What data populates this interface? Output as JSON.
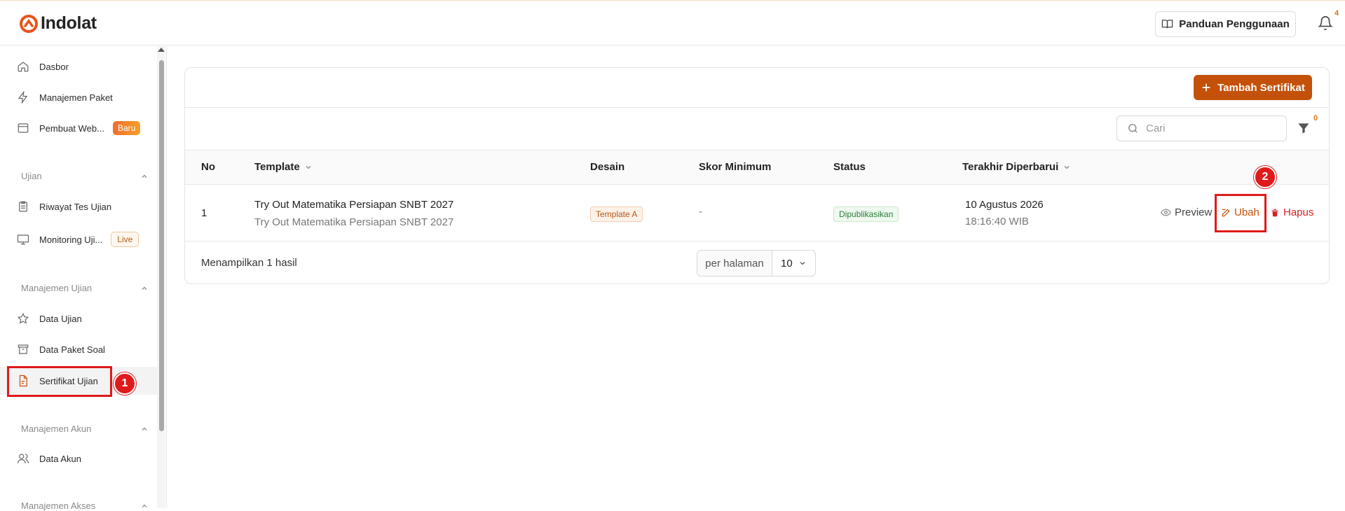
{
  "header": {
    "logo_text": "Indolat",
    "guide_label": "Panduan Penggunaan",
    "notification_count": "4",
    "brand_color": "#e8541a"
  },
  "sidebar": {
    "items_top": [
      {
        "label": "Dasbor",
        "icon": "home-icon"
      },
      {
        "label": "Manajemen Paket",
        "icon": "bolt-icon"
      },
      {
        "label": "Pembuat Web...",
        "icon": "browser-icon",
        "badge": "Baru"
      }
    ],
    "section_ujian": "Ujian",
    "items_ujian": [
      {
        "label": "Riwayat Tes Ujian",
        "icon": "clipboard-icon"
      },
      {
        "label": "Monitoring Uji...",
        "icon": "monitor-icon",
        "badge": "Live"
      }
    ],
    "section_manajemen_ujian": "Manajemen Ujian",
    "items_manajemen_ujian": [
      {
        "label": "Data Ujian",
        "icon": "star-icon"
      },
      {
        "label": "Data Paket Soal",
        "icon": "archive-icon"
      },
      {
        "label": "Sertifikat Ujian",
        "icon": "document-icon",
        "active": true
      }
    ],
    "section_manajemen_akun": "Manajemen Akun",
    "items_manajemen_akun": [
      {
        "label": "Data Akun",
        "icon": "users-icon"
      }
    ],
    "section_manajemen_akses": "Manajemen Akses"
  },
  "toolbar": {
    "add_label": "Tambah Sertifikat",
    "search_placeholder": "Cari",
    "filter_count": "0"
  },
  "table": {
    "columns": [
      "No",
      "Template",
      "Desain",
      "Skor Minimum",
      "Status",
      "Terakhir Diperbarui"
    ],
    "rows": [
      {
        "no": "1",
        "template_title": "Try Out Matematika Persiapan SNBT 2027",
        "template_subtitle": "Try Out Matematika Persiapan SNBT 2027",
        "design": "Template A",
        "min_score": "-",
        "status": "Dipublikasikan",
        "updated_date": "10 Agustus 2026",
        "updated_time": "18:16:40 WIB"
      }
    ],
    "actions": {
      "preview": "Preview",
      "edit": "Ubah",
      "delete": "Hapus"
    }
  },
  "footer": {
    "results_text": "Menampilkan 1 hasil",
    "per_page_label": "per halaman",
    "per_page_value": "10"
  },
  "annotations": {
    "marker_1": "1",
    "marker_2": "2"
  }
}
